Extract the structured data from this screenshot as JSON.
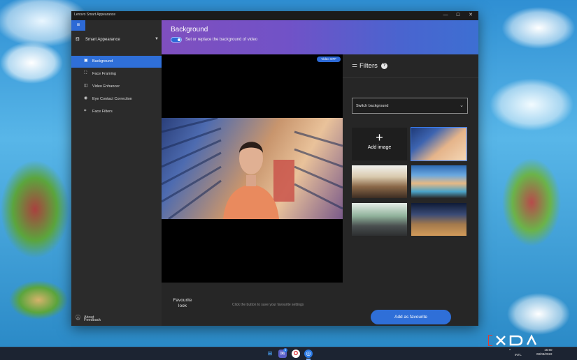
{
  "window": {
    "title": "Lenovo Smart Appearance",
    "controls": {
      "minimize": "—",
      "maximize": "☐",
      "close": "✕"
    }
  },
  "sidebar": {
    "menu_icon": "≡",
    "group_label": "Smart Appearance",
    "items": [
      {
        "label": "Background",
        "icon": "background-icon",
        "active": true
      },
      {
        "label": "Face Framing",
        "icon": "face-framing-icon",
        "active": false
      },
      {
        "label": "Video Enhancer",
        "icon": "video-enhancer-icon",
        "active": false
      },
      {
        "label": "Eye Contact Correction",
        "icon": "eye-contact-icon",
        "active": false
      },
      {
        "label": "Face Filters",
        "icon": "face-filters-icon",
        "active": false
      }
    ],
    "bottom": [
      {
        "label": "About",
        "icon": "info-icon"
      },
      {
        "label": "Feedback",
        "icon": "feedback-icon"
      }
    ]
  },
  "header": {
    "title": "Background",
    "subtitle": "Set or replace the background of video",
    "toggle_on": true
  },
  "video": {
    "status_button": "Video OFF"
  },
  "favourite": {
    "label": "Favourite look",
    "hint": "Click the button to save your favourite settings",
    "button": "Add as favourite"
  },
  "filters": {
    "title": "Filters",
    "info_glyph": "?",
    "select_value": "Switch background",
    "add_image": "Add image"
  },
  "taskbar": {
    "chat_badge": "3",
    "input_lang": "INTL",
    "time": "15:50",
    "date": "08/08/2022"
  },
  "watermark": {
    "text": "XDA"
  },
  "colors": {
    "accent": "#2f6fd8",
    "sidebar_bg": "#2b2b2b",
    "panel_bg": "#262626"
  }
}
